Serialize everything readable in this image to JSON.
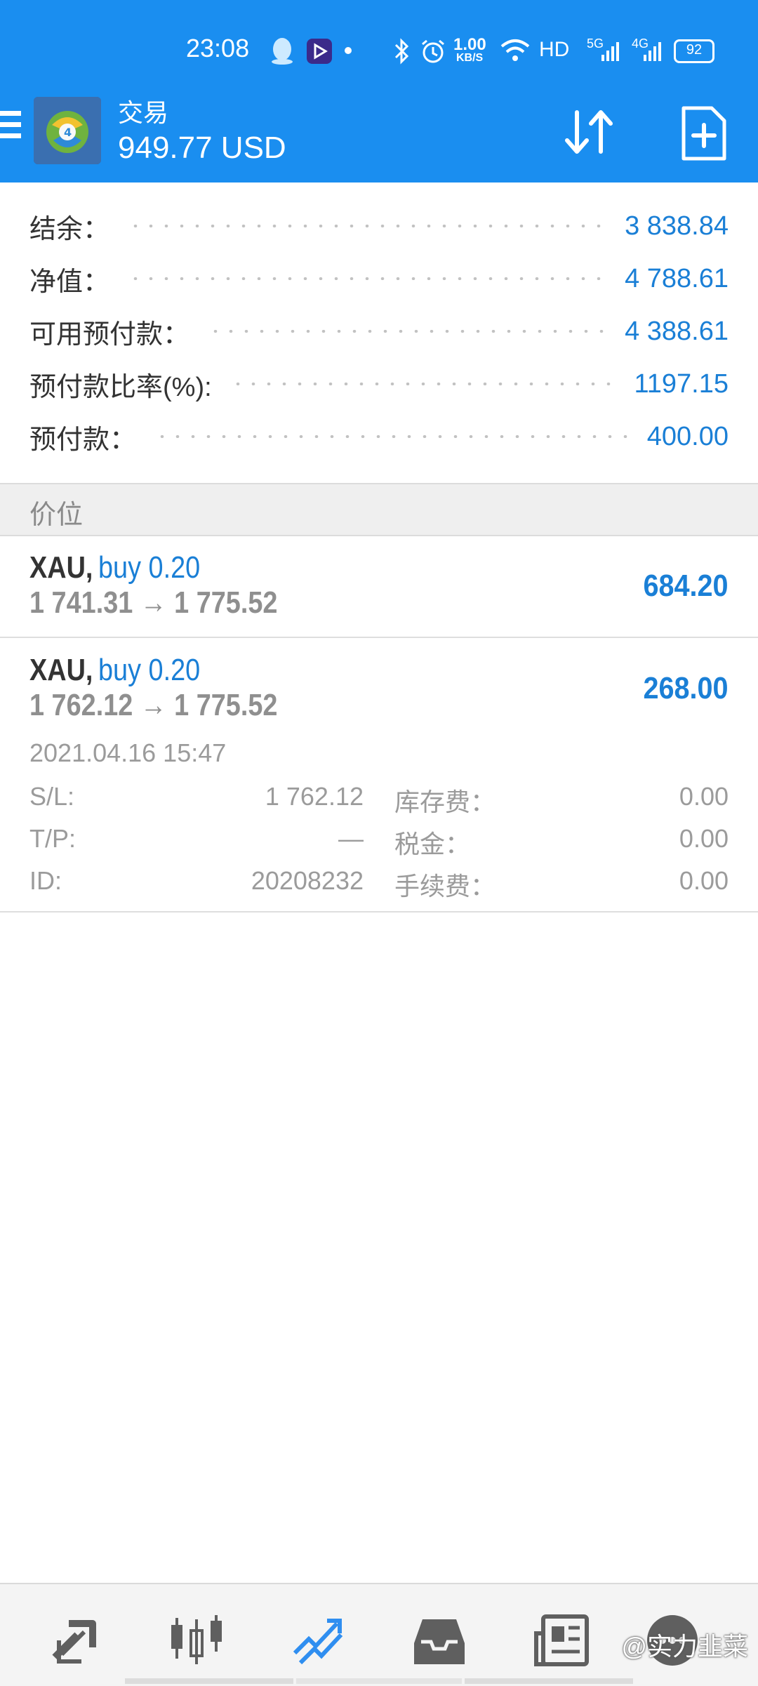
{
  "status_bar": {
    "time": "23:08",
    "net_speed_value": "1.00",
    "net_speed_unit": "KB/S",
    "hd_label": "HD",
    "signal_5g": "5G",
    "signal_4g": "4G",
    "battery": "92",
    "icons": [
      "qq-icon",
      "video-app-icon",
      "notification-dot-icon",
      "bluetooth-icon",
      "alarm-icon",
      "wifi-icon",
      "signal-icon",
      "battery-icon"
    ]
  },
  "app_bar": {
    "title": "交易",
    "balance": "949.77 USD",
    "icons": [
      "menu-icon",
      "metatrader-logo-icon",
      "sort-arrows-icon",
      "new-order-icon"
    ]
  },
  "summary": [
    {
      "label": "结余：",
      "value": "3 838.84"
    },
    {
      "label": "净值：",
      "value": "4 788.61"
    },
    {
      "label": "可用预付款：",
      "value": "4 388.61"
    },
    {
      "label": "预付款比率(%):",
      "value": "1197.15"
    },
    {
      "label": "预付款：",
      "value": "400.00"
    }
  ],
  "section_header": "价位",
  "positions": [
    {
      "symbol": "XAU,",
      "side": "buy 0.20",
      "prices": "1 741.31 → 1 775.52",
      "profit": "684.20"
    },
    {
      "symbol": "XAU,",
      "side": "buy 0.20",
      "prices": "1 762.12 → 1 775.52",
      "profit": "268.00",
      "time": "2021.04.16 15:47",
      "details": {
        "sl_label": "S/L:",
        "sl_value": "1 762.12",
        "swap_label": "库存费：",
        "swap_value": "0.00",
        "tp_label": "T/P:",
        "tp_value": "—",
        "tax_label": "税金：",
        "tax_value": "0.00",
        "id_label": "ID:",
        "id_value": "20208232",
        "commission_label": "手续费：",
        "commission_value": "0.00"
      }
    }
  ],
  "bottom_nav": {
    "items": [
      "quotes-icon",
      "chart-icon",
      "trade-icon",
      "history-icon",
      "news-icon",
      "chat-icon"
    ],
    "active": "trade-icon",
    "watermark": "@实力韭菜"
  },
  "colors": {
    "primary": "#1a8ef0",
    "value_blue": "#1a7fd6",
    "muted_gray": "#8f8f8f"
  }
}
